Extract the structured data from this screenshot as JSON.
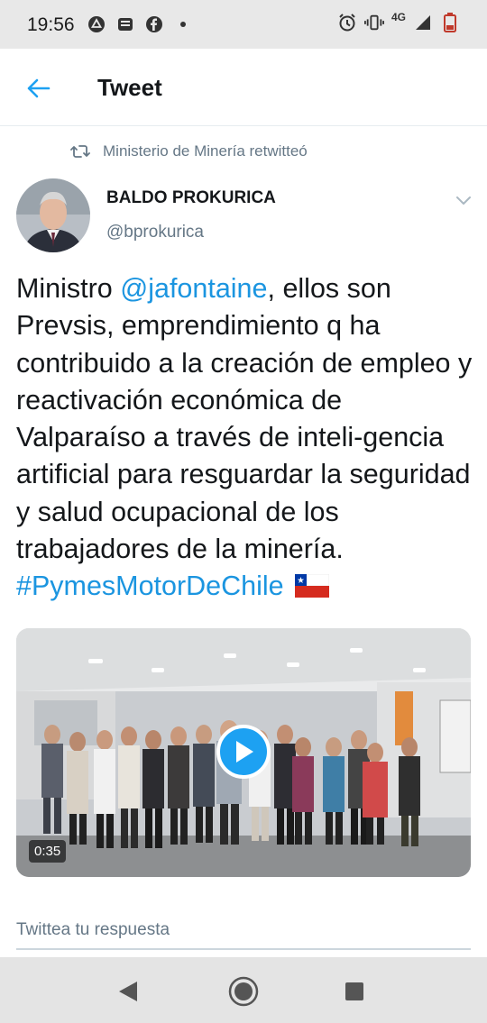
{
  "status_bar": {
    "time": "19:56",
    "network": "4G",
    "icons": [
      "drive-icon",
      "news-icon",
      "facebook-icon",
      "dot-icon",
      "alarm-icon",
      "vibrate-icon",
      "signal-icon",
      "battery-icon"
    ]
  },
  "header": {
    "title": "Tweet",
    "back_icon": "arrow-left-icon",
    "accent_color": "#1da1f2"
  },
  "tweet": {
    "retweet_label": "Ministerio de Minería retwitteó",
    "author_name": "BALDO PROKURICA",
    "author_handle": "@bprokurica",
    "text_part_1": "Ministro ",
    "mention": "@jafontaine",
    "text_part_2": ", ellos son Prevsis, emprendimiento q ha contribuido a la creación de empleo y reactivación económica de Valparaíso a través de inteli-gencia artificial para resguardar la seguridad y salud ocupacional de los trabajadores de la minería.",
    "hashtag": "#PymesMotorDeChile",
    "flag_icon": "chile-flag-icon",
    "video_duration": "0:35"
  },
  "reply": {
    "placeholder": "Twittea tu respuesta"
  },
  "nav": {
    "icons": [
      "back-triangle-icon",
      "home-circle-icon",
      "recents-square-icon"
    ]
  }
}
